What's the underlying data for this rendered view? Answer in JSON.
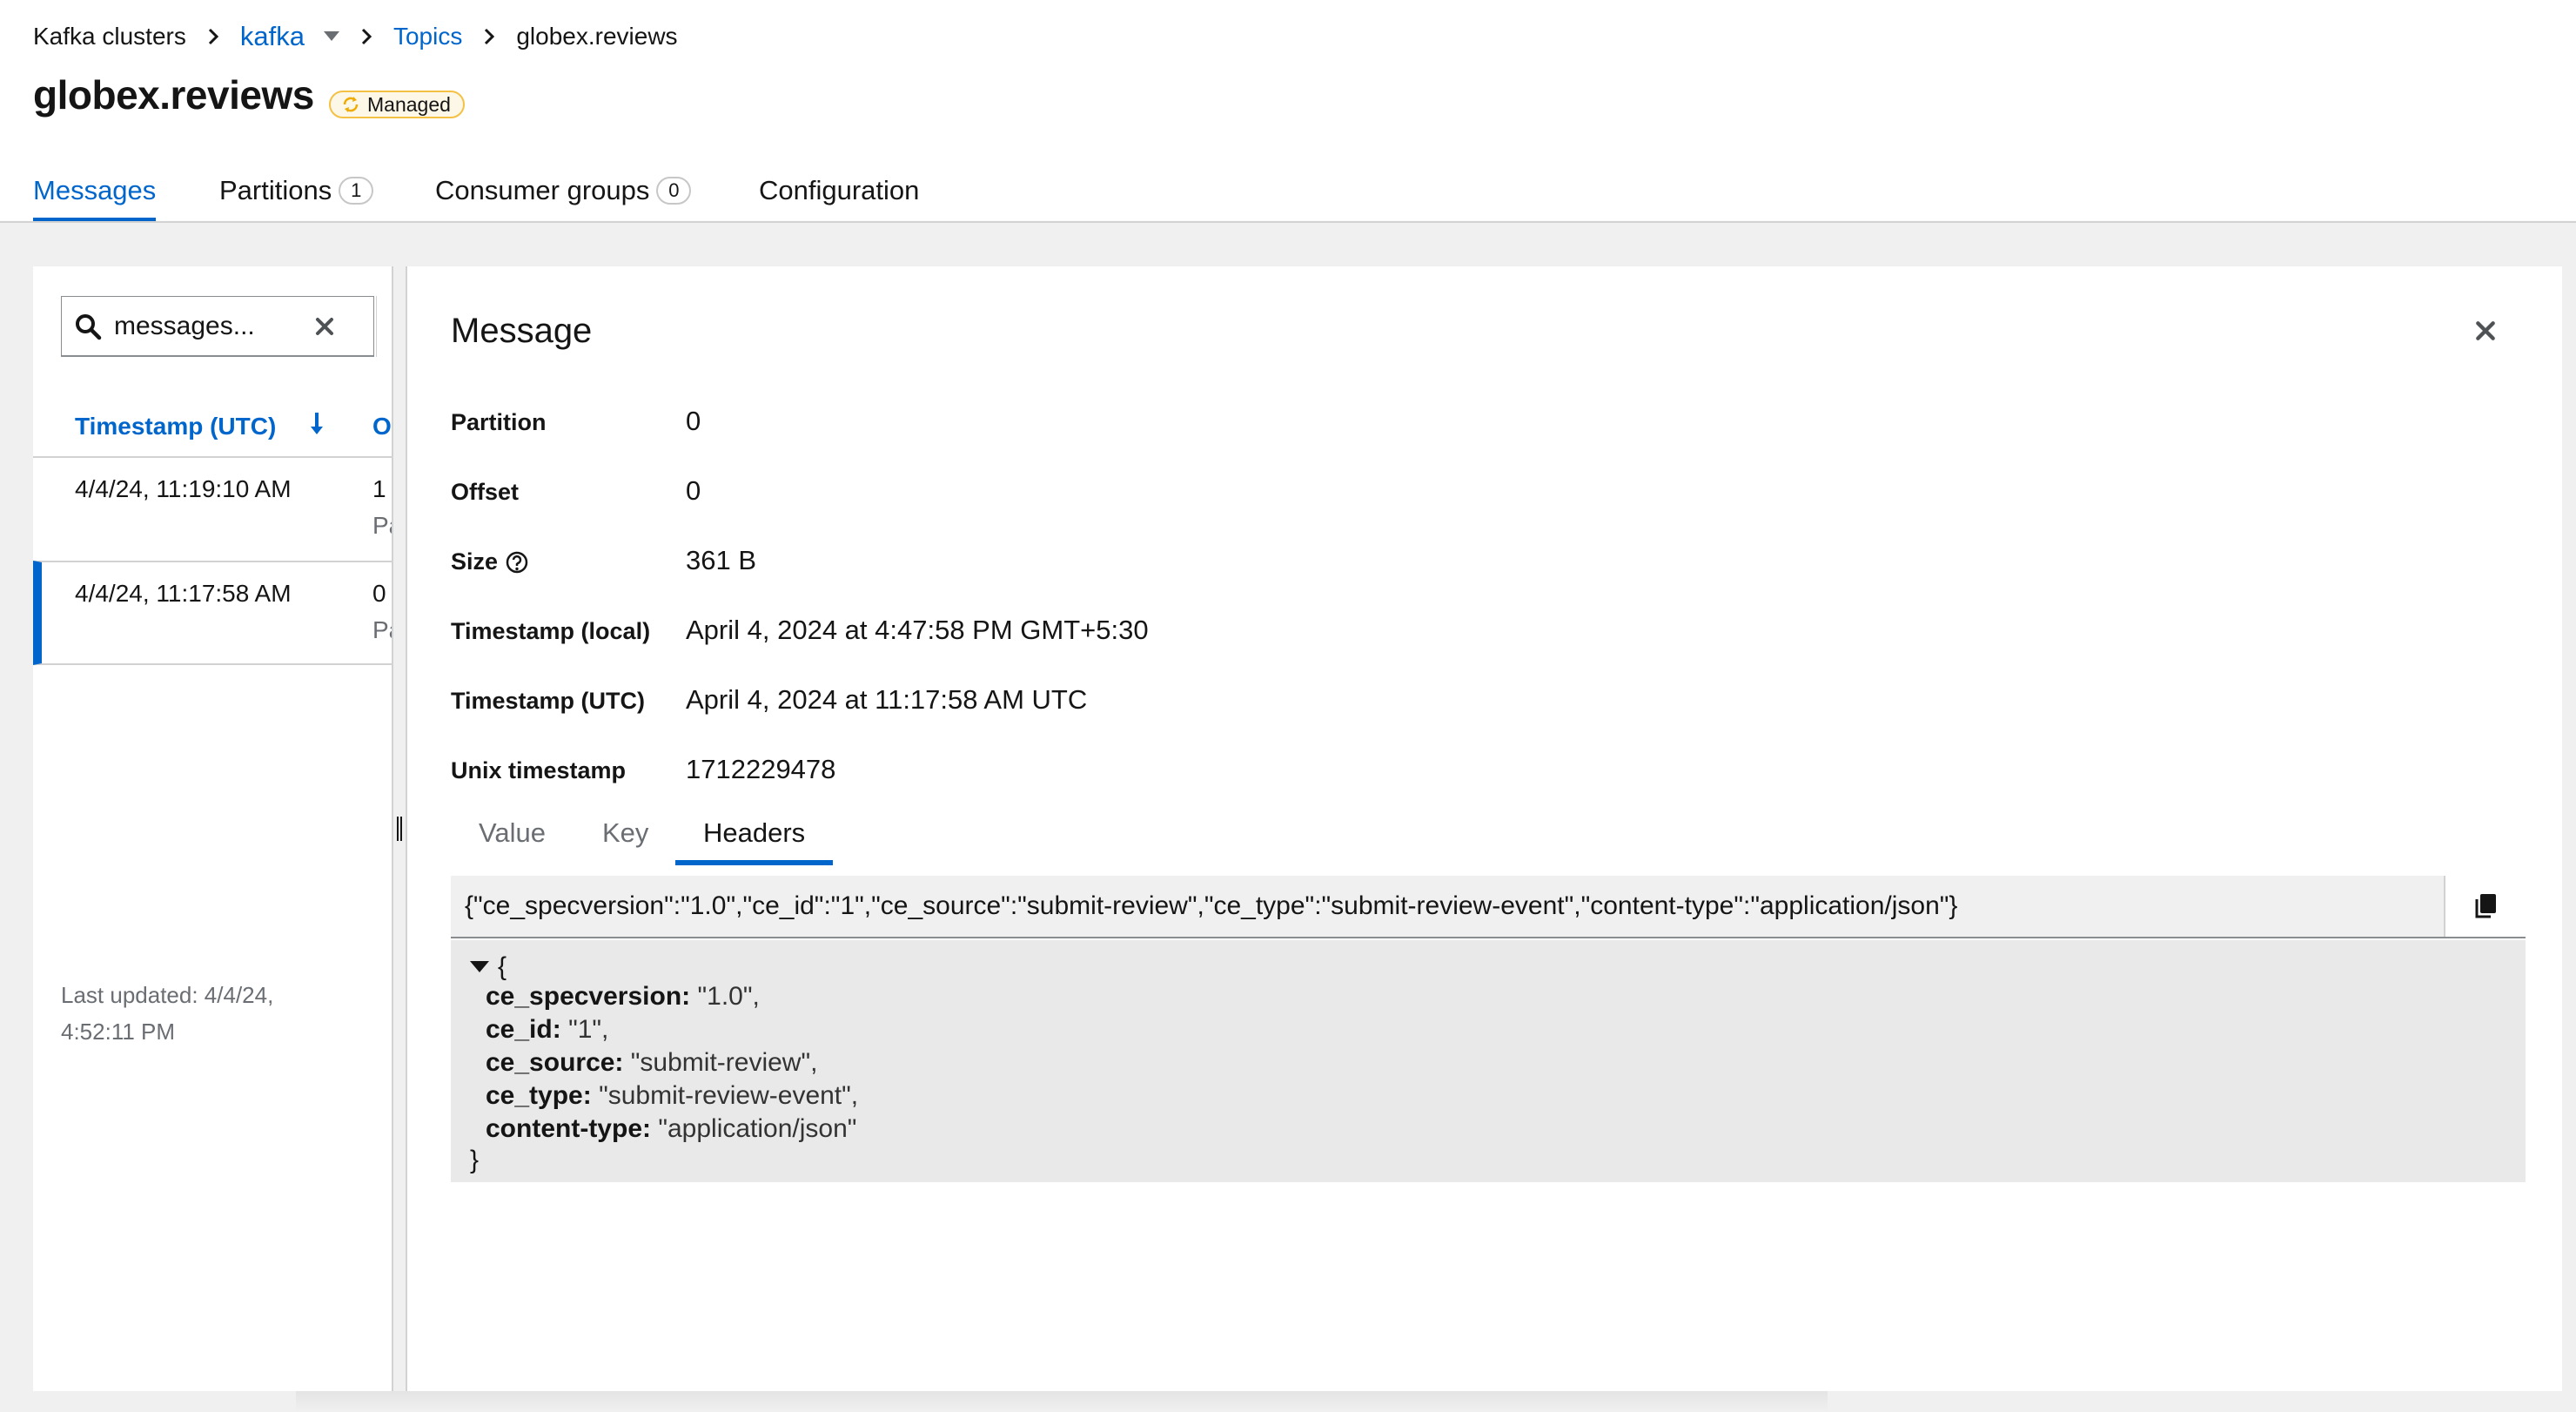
{
  "breadcrumb": {
    "root": "Kafka clusters",
    "cluster": "kafka",
    "topics": "Topics",
    "current": "globex.reviews"
  },
  "page": {
    "title": "globex.reviews",
    "badge": "Managed"
  },
  "tabs": [
    {
      "label": "Messages",
      "count": null,
      "active": true
    },
    {
      "label": "Partitions",
      "count": "1",
      "active": false
    },
    {
      "label": "Consumer groups",
      "count": "0",
      "active": false
    },
    {
      "label": "Configuration",
      "count": null,
      "active": false
    }
  ],
  "list": {
    "search_value": "messages...",
    "columns": {
      "timestamp": "Timestamp (UTC)",
      "offset": "O"
    },
    "rows": [
      {
        "timestamp": "4/4/24, 11:19:10 AM",
        "offset": "1",
        "partition": "Pa",
        "selected": false
      },
      {
        "timestamp": "4/4/24, 11:17:58 AM",
        "offset": "0",
        "partition": "Pa",
        "selected": true
      }
    ],
    "last_updated_label": "Last updated: 4/4/24,",
    "last_updated_time": "4:52:11 PM"
  },
  "detail": {
    "title": "Message",
    "fields": [
      {
        "term": "Partition",
        "value": "0"
      },
      {
        "term": "Offset",
        "value": "0"
      },
      {
        "term": "Size",
        "value": "361 B",
        "help": true
      },
      {
        "term": "Timestamp (local)",
        "value": "April 4, 2024 at 4:47:58 PM GMT+5:30"
      },
      {
        "term": "Timestamp (UTC)",
        "value": "April 4, 2024 at 11:17:58 AM UTC"
      },
      {
        "term": "Unix timestamp",
        "value": "1712229478"
      }
    ],
    "sub_tabs": [
      "Value",
      "Key",
      "Headers"
    ],
    "active_sub_tab": "Headers",
    "raw_headers": "{\"ce_specversion\":\"1.0\",\"ce_id\":\"1\",\"ce_source\":\"submit-review\",\"ce_type\":\"submit-review-event\",\"content-type\":\"application/json\"}",
    "json_open": "{",
    "json_close": "}",
    "json_entries": [
      {
        "key": "ce_specversion:",
        "value": "\"1.0\","
      },
      {
        "key": "ce_id:",
        "value": "\"1\","
      },
      {
        "key": "ce_source:",
        "value": "\"submit-review\","
      },
      {
        "key": "ce_type:",
        "value": "\"submit-review-event\","
      },
      {
        "key": "content-type:",
        "value": "\"application/json\""
      }
    ]
  },
  "icons": [
    "chevron-right-icon",
    "caret-down-icon",
    "sync-icon",
    "search-icon",
    "times-icon",
    "filter-icon",
    "arrow-down-icon",
    "help-icon",
    "copy-icon",
    "caret-down-small-icon",
    "grip-icon"
  ],
  "colors": {
    "link": "#0066cc",
    "badge_border": "#f4c145",
    "badge_bg": "#fdf7e7",
    "panel_bg": "#f0f0f0",
    "code_bg": "#e9e9e9"
  }
}
